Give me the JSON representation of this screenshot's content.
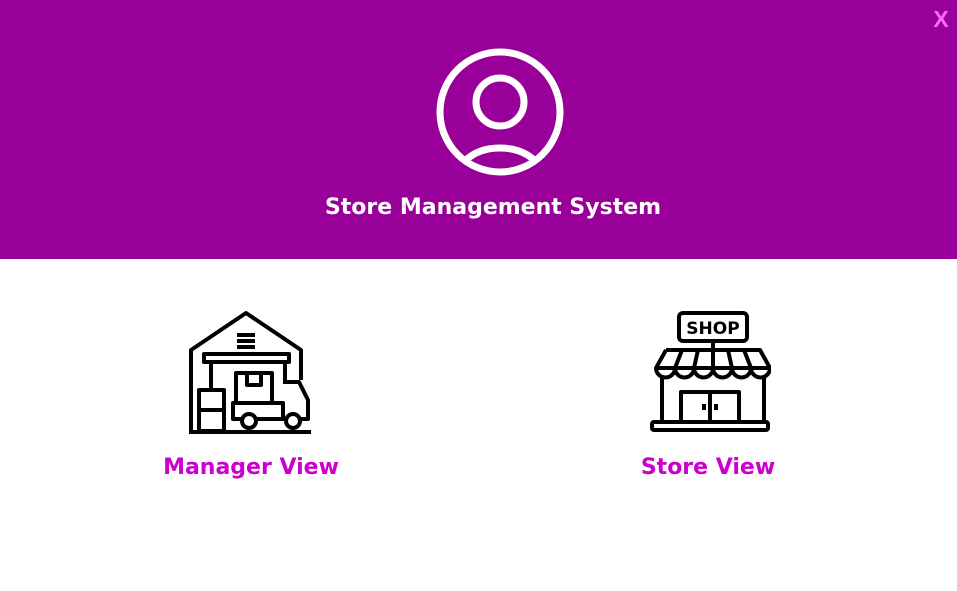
{
  "window": {
    "close_label": "X",
    "title": "Store Management System"
  },
  "header": {
    "avatar_icon": "user-circle-icon"
  },
  "options": [
    {
      "label": "Manager View",
      "icon": "warehouse-truck-icon"
    },
    {
      "label": "Store View",
      "icon": "shop-storefront-icon"
    }
  ],
  "colors": {
    "header_background": "#990099",
    "accent": "#cc00cc",
    "close": "#ff66ff",
    "header_text": "#ffffff",
    "icon_stroke": "#000000"
  }
}
